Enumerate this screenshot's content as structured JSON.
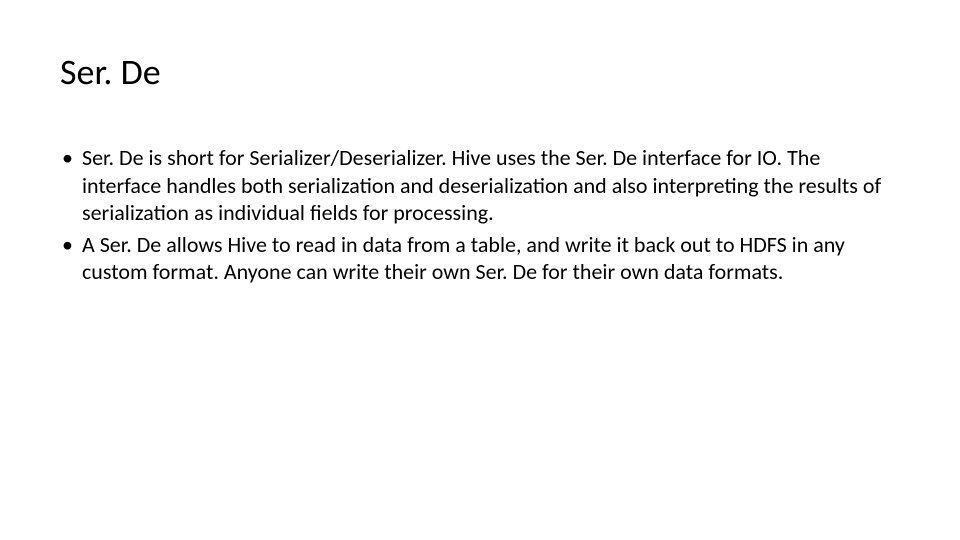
{
  "slide": {
    "title": "Ser. De",
    "bullets": [
      "Ser. De is short for Serializer/Deserializer. Hive uses the Ser. De interface for IO. The interface handles both serialization and deserialization and also interpreting the results of serialization as individual fields for processing.",
      "A Ser. De allows Hive to read in data from a table, and write it back out to HDFS in any custom format. Anyone can write their own Ser. De for their own data formats."
    ]
  }
}
